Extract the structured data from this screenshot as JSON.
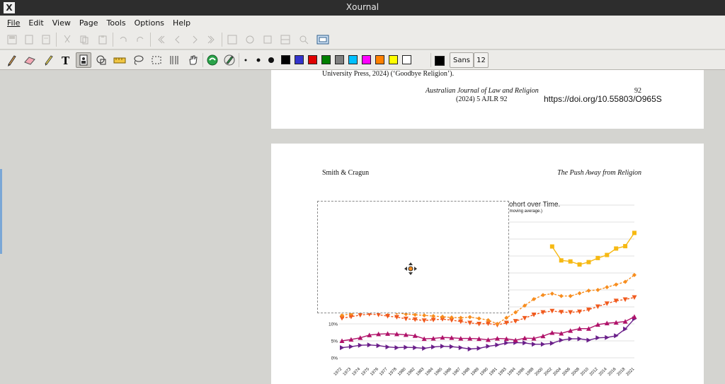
{
  "window": {
    "title": "Xournal",
    "app_icon": "X"
  },
  "menu": [
    "File",
    "Edit",
    "View",
    "Page",
    "Tools",
    "Options",
    "Help"
  ],
  "toolbar_text": {
    "font": "Sans",
    "size": "12"
  },
  "colors": [
    "#000000",
    "#3333cc",
    "#e00000",
    "#007f00",
    "#7f7f7f",
    "#00c0ff",
    "#ff00ff",
    "#ff8000",
    "#ffff00",
    "#ffffff"
  ],
  "current_color": "#000000",
  "page_prev": {
    "reference": "University Press, 2024) (‘Goodbye Religion’).",
    "journal": "Australian Journal of Law and Religion",
    "page_number": "92",
    "citation": "(2024) 5 AJLR 92",
    "doi": "https://doi.org/10.55803/O965S"
  },
  "page_current": {
    "header_left": "Smith & Cragun",
    "header_right": "The Push Away from Religion",
    "figure_title_fragment": "ohort over Time.",
    "figure_subtitle_fragment": "r moving average.)"
  },
  "chart_data": {
    "type": "line",
    "x": [
      "1972",
      "1973",
      "1974",
      "1975",
      "1976",
      "1977",
      "1978",
      "1980",
      "1982",
      "1983",
      "1984",
      "1985",
      "1986",
      "1987",
      "1988",
      "1989",
      "1990",
      "1991",
      "1993",
      "1994",
      "1996",
      "1998",
      "2000",
      "2002",
      "2004",
      "2006",
      "2008",
      "2010",
      "2012",
      "2014",
      "2016",
      "2018",
      "2021"
    ],
    "yticks": [
      "0%",
      "5%",
      "10%"
    ],
    "ylim": [
      0,
      45
    ],
    "series": [
      {
        "color": "#6a1f8a",
        "marker": "triangle-right",
        "values": [
          3.0,
          3.3,
          3.7,
          3.8,
          3.6,
          3.2,
          3.0,
          3.1,
          3.0,
          2.8,
          3.2,
          3.4,
          3.3,
          3.0,
          2.6,
          2.8,
          3.4,
          3.8,
          4.4,
          4.5,
          4.4,
          4.0,
          4.0,
          4.3,
          5.2,
          5.6,
          5.6,
          5.2,
          5.9,
          6.0,
          6.5,
          8.5,
          11.5
        ]
      },
      {
        "color": "#b0136a",
        "marker": "triangle-up",
        "values": [
          5.0,
          5.4,
          5.9,
          6.7,
          7.0,
          7.1,
          7.0,
          6.8,
          6.5,
          5.6,
          5.7,
          6.0,
          5.9,
          5.7,
          5.7,
          5.6,
          5.3,
          5.7,
          5.6,
          5.2,
          5.8,
          5.7,
          6.4,
          7.4,
          7.2,
          8.0,
          8.6,
          8.6,
          9.8,
          10.2,
          10.4,
          10.7,
          12.1
        ]
      },
      {
        "color": "#f05a1e",
        "marker": "triangle-down",
        "values": [
          11.7,
          12.1,
          12.6,
          12.9,
          12.7,
          12.3,
          12.0,
          11.5,
          11.3,
          11.0,
          11.2,
          11.4,
          11.1,
          10.7,
          10.3,
          10.0,
          10.1,
          9.7,
          10.3,
          10.8,
          11.7,
          12.7,
          13.4,
          13.8,
          13.5,
          13.4,
          13.6,
          14.2,
          15.1,
          16.0,
          16.8,
          17.2,
          17.8
        ]
      },
      {
        "color": "#f78d1e",
        "marker": "diamond",
        "values": [
          12.5,
          13.0,
          13.6,
          14.0,
          13.8,
          13.5,
          13.3,
          12.9,
          12.7,
          12.5,
          12.3,
          12.1,
          11.9,
          11.8,
          12.0,
          11.6,
          11.1,
          10.0,
          11.8,
          13.4,
          15.4,
          17.3,
          18.5,
          18.9,
          18.2,
          18.2,
          19.0,
          19.8,
          20.0,
          20.8,
          21.6,
          22.4,
          24.4
        ]
      },
      {
        "color": "#f6b913",
        "marker": "square",
        "values": [
          null,
          null,
          null,
          null,
          null,
          null,
          null,
          null,
          null,
          null,
          null,
          null,
          null,
          null,
          null,
          null,
          null,
          null,
          null,
          null,
          null,
          null,
          null,
          32.8,
          28.7,
          28.4,
          27.5,
          28.2,
          29.4,
          30.3,
          32.2,
          32.9,
          36.8
        ]
      }
    ]
  }
}
